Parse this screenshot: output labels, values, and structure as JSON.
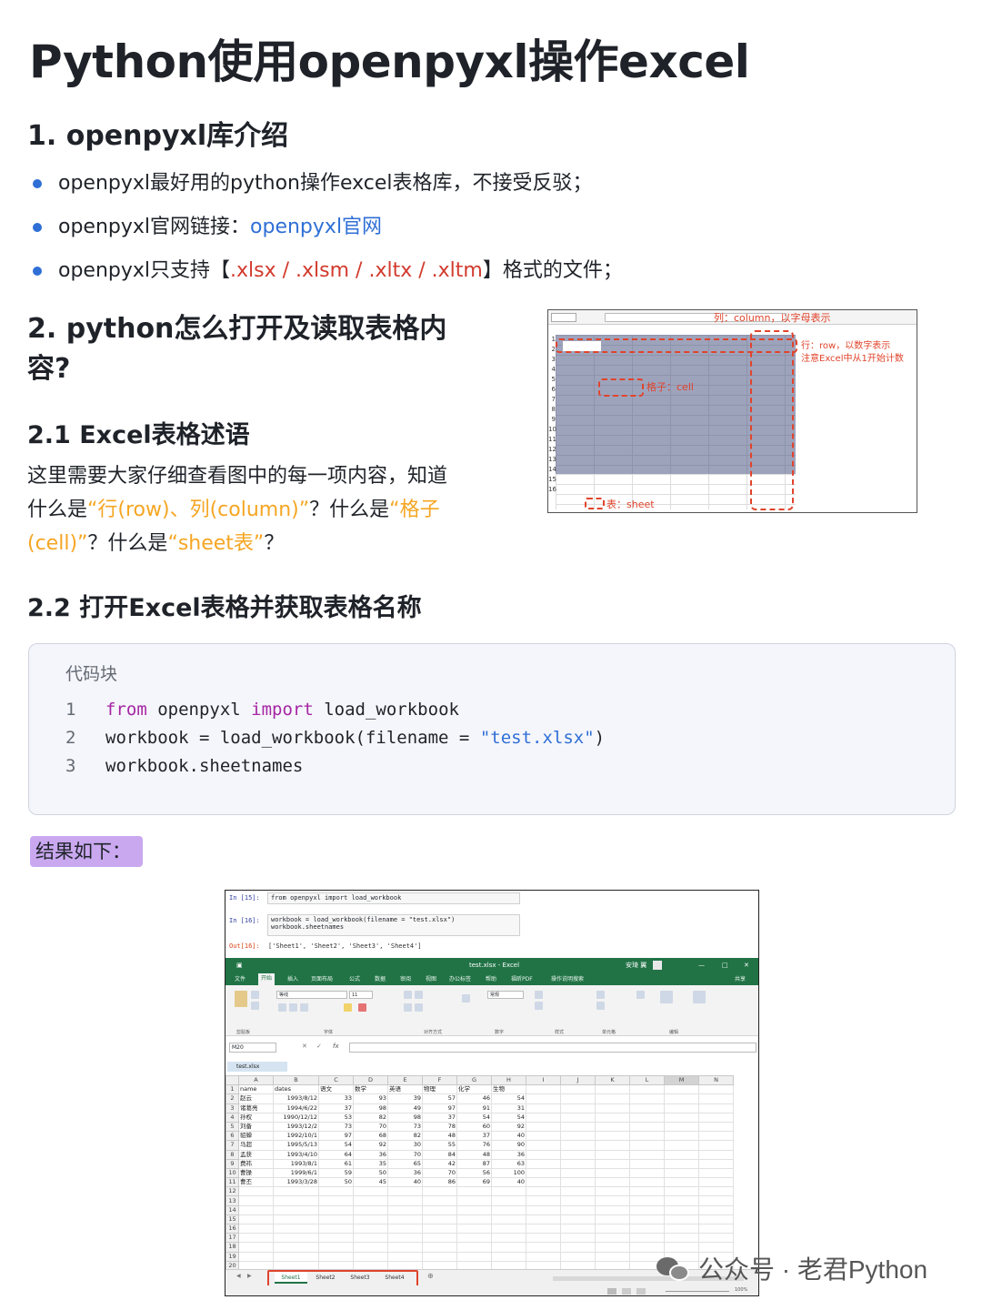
{
  "title": "Python使用openpyxl操作excel",
  "section1": {
    "heading": "1. openpyxl库介绍",
    "bullets": [
      {
        "text": "openpyxl最好用的python操作excel表格库，不接受反驳；"
      },
      {
        "prefix": "openpyxl官网链接：",
        "link": "openpyxl官网"
      },
      {
        "prefix": "openpyxl只支持【",
        "formats": ".xlsx / .xlsm / .xltx / .xltm",
        "suffix": "】格式的文件；"
      }
    ]
  },
  "section2": {
    "heading_line1": "2. python怎么打开及读取表格内",
    "heading_line2": "容?",
    "sub1": "2.1 Excel表格述语",
    "para": {
      "p1": "这里需要大家仔细查看图中的每一项内容，知道",
      "p2": "什么是",
      "h1": "“行(row)、列(column)”",
      "p3": "？什么是",
      "h2": "“格子",
      "h2b": "(cell)”",
      "p4": "？什么是",
      "h3": "“sheet表”",
      "p5": "？"
    },
    "sub2": "2.2 打开Excel表格并获取表格名称"
  },
  "diagram": {
    "col_label": "列：column，以字母表示",
    "row_label_1": "行：row，以数字表示",
    "row_label_2": "注意Excel中从1开始计数",
    "cell_label": "格子：cell",
    "sheet_label": "表：sheet",
    "row_numbers": [
      "1",
      "2",
      "3",
      "4",
      "5",
      "6",
      "7",
      "8",
      "9",
      "10",
      "11",
      "12",
      "13",
      "14",
      "15",
      "16"
    ]
  },
  "code": {
    "title": "代码块",
    "lines": [
      {
        "n": "1",
        "kw1": "from",
        "t1": " openpyxl ",
        "kw2": "import",
        "t2": " load_workbook"
      },
      {
        "n": "2",
        "t1": "workbook = load_workbook(filename = ",
        "str": "\"test.xlsx\"",
        "t2": ")"
      },
      {
        "n": "3",
        "t1": "workbook.sheetnames"
      }
    ]
  },
  "result_label": "结果如下：",
  "screenshot": {
    "in15_prompt": "In  [15]:",
    "in15_code": "from openpyxl import load_workbook",
    "in16_prompt": "In  [16]:",
    "in16_code1": "workbook = load_workbook(filename = \"test.xlsx\")",
    "in16_code2": "workbook.sheetnames",
    "out16_prompt": "Out[16]:",
    "out16_value": "['Sheet1', 'Sheet2', 'Sheet3', 'Sheet4']",
    "excel_title": "test.xlsx  -  Excel",
    "user": "安琦 翼",
    "ribbon_tabs": [
      "文件",
      "开始",
      "插入",
      "页面布局",
      "公式",
      "数据",
      "审阅",
      "视图",
      "办公标签",
      "帮助",
      "福昕PDF",
      "操作说明搜索"
    ],
    "share": "共享",
    "font_name": "等线",
    "font_size": "11",
    "number_format": "常规",
    "groups": [
      "剪贴板",
      "字体",
      "对齐方式",
      "数字",
      "样式",
      "单元格",
      "编辑"
    ],
    "name_box": "M20",
    "doc_tab": "test.xlsx",
    "col_headers": [
      "A",
      "B",
      "C",
      "D",
      "E",
      "F",
      "G",
      "H",
      "I",
      "J",
      "K",
      "L",
      "M",
      "N"
    ],
    "header_row": [
      "name",
      "dates",
      "语文",
      "数学",
      "英语",
      "物理",
      "化学",
      "生物"
    ],
    "rows": [
      [
        "赵云",
        "1993/8/12",
        "33",
        "93",
        "39",
        "57",
        "46",
        "54"
      ],
      [
        "诸葛亮",
        "1994/6/22",
        "37",
        "98",
        "49",
        "97",
        "91",
        "31"
      ],
      [
        "孙权",
        "1990/12/12",
        "53",
        "82",
        "98",
        "37",
        "54",
        "54"
      ],
      [
        "刘备",
        "1993/12/2",
        "73",
        "70",
        "73",
        "78",
        "60",
        "92"
      ],
      [
        "貂蝉",
        "1992/10/1",
        "97",
        "68",
        "82",
        "48",
        "37",
        "40"
      ],
      [
        "马超",
        "1995/5/13",
        "54",
        "92",
        "30",
        "55",
        "76",
        "90"
      ],
      [
        "孟获",
        "1993/4/10",
        "64",
        "36",
        "70",
        "84",
        "48",
        "36"
      ],
      [
        "费祎",
        "1993/8/1",
        "61",
        "35",
        "65",
        "42",
        "87",
        "63"
      ],
      [
        "曹操",
        "1999/6/1",
        "59",
        "50",
        "36",
        "70",
        "56",
        "100"
      ],
      [
        "曹丕",
        "1993/3/28",
        "50",
        "45",
        "40",
        "86",
        "69",
        "40"
      ]
    ],
    "row_numbers": [
      "1",
      "2",
      "3",
      "4",
      "5",
      "6",
      "7",
      "8",
      "9",
      "10",
      "11",
      "12",
      "13",
      "14",
      "15",
      "16",
      "17",
      "18",
      "19",
      "20"
    ],
    "sheet_tabs": [
      "Sheet1",
      "Sheet2",
      "Sheet3",
      "Sheet4"
    ],
    "zoom": "100%"
  },
  "watermark": {
    "text": "公众号 · 老君Python"
  }
}
